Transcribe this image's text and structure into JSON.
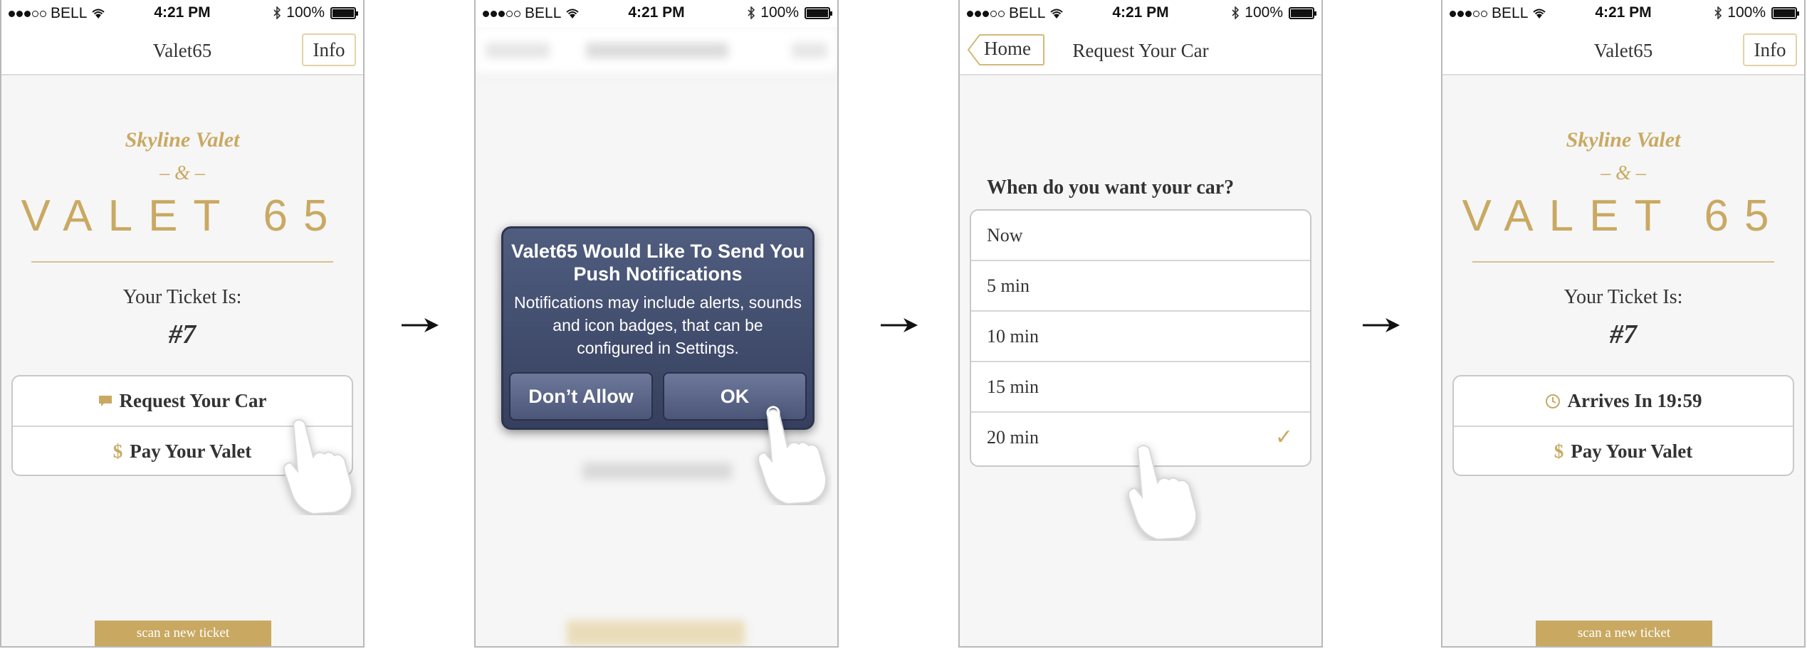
{
  "status_bar": {
    "carrier": "BELL",
    "time": "4:21 PM",
    "battery": "100%",
    "battery_level": 1.0
  },
  "screens": {
    "home": {
      "nav_title": "Valet65",
      "info_label": "Info",
      "brand_line1": "Skyline Valet",
      "brand_amp": "– & –",
      "brand_logo": "VALET 65",
      "ticket_label": "Your Ticket Is:",
      "ticket_number": "#7",
      "request_label": "Request Your Car",
      "pay_label": "Pay Your Valet",
      "pay_icon": "$",
      "scan_label": "scan a new ticket"
    },
    "alert": {
      "title": "Valet65 Would Like To Send You Push Notifications",
      "message": "Notifications may include alerts, sounds and icon badges, that can be configured in Settings.",
      "dont_allow": "Don’t Allow",
      "ok": "OK"
    },
    "request": {
      "back_label": "Home",
      "nav_title": "Request Your Car",
      "question": "When do you want your car?",
      "options": [
        {
          "label": "Now"
        },
        {
          "label": "5 min"
        },
        {
          "label": "10 min"
        },
        {
          "label": "15 min"
        },
        {
          "label": "20 min"
        }
      ],
      "selected_index": 4,
      "check_icon": "✓"
    },
    "arrived": {
      "arrives_label": "Arrives In 19:59"
    }
  },
  "colors": {
    "accent": "#c9a962",
    "alert_bg": "#434d6e"
  },
  "icons": [
    "signal-icon",
    "wifi-icon",
    "bluetooth-icon",
    "battery-icon",
    "chat-icon",
    "dollar-icon",
    "clock-icon",
    "pointing-hand-icon",
    "arrow-right-icon",
    "checkmark-icon"
  ]
}
